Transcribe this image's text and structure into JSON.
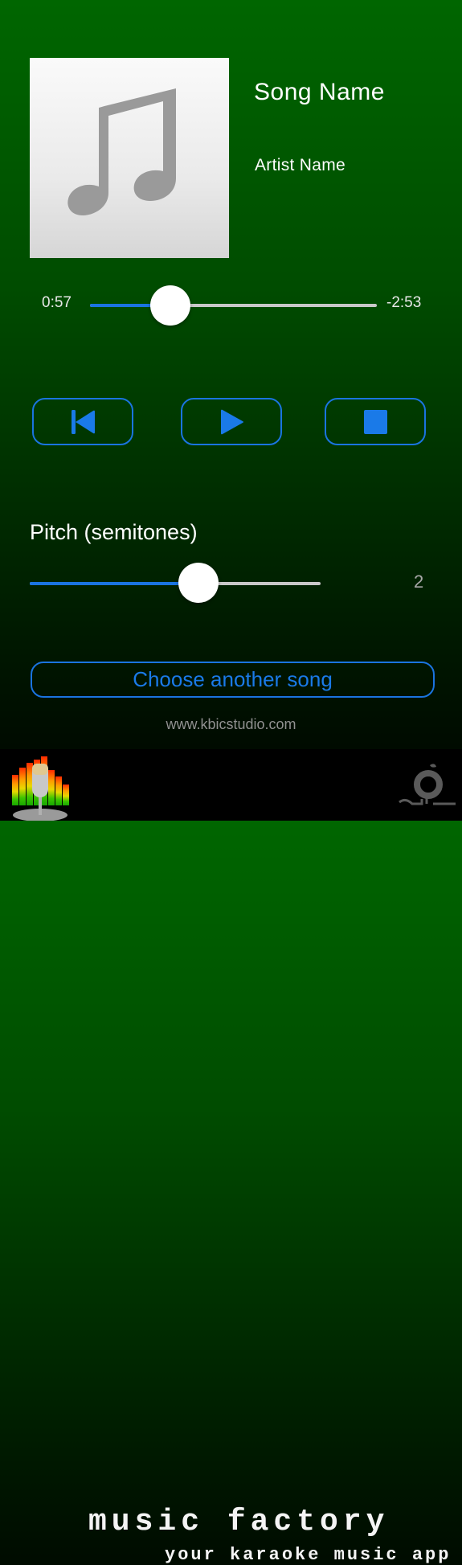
{
  "now_playing": {
    "song_name": "Song Name",
    "artist_name": "Artist Name",
    "album_art_icon": "music-note-icon"
  },
  "progress": {
    "elapsed": "0:57",
    "remaining": "-2:53",
    "fraction": 0.28
  },
  "controls": {
    "previous_icon": "skip-back-icon",
    "play_icon": "play-icon",
    "stop_icon": "stop-icon"
  },
  "pitch": {
    "label": "Pitch (semitones)",
    "value": "2",
    "fraction": 0.58
  },
  "choose_song_label": "Choose another song",
  "website": "www.kbicstudio.com",
  "banner": {
    "title": "music factory",
    "subtitle": "your karaoke music app"
  },
  "colors": {
    "accent": "#1a74e0",
    "track_empty": "#c8c8c8"
  }
}
